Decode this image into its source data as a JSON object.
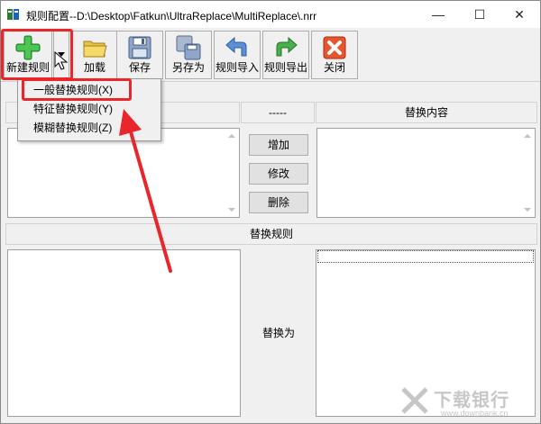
{
  "window": {
    "title": "规则配置--D:\\Desktop\\Fatkun\\UltraReplace\\MultiReplace\\.nrr",
    "minimize_glyph": "—",
    "maximize_glyph": "☐",
    "close_glyph": "✕"
  },
  "toolbar": {
    "new_rule_label": "新建规则",
    "load_label": "加载",
    "save_label": "保存",
    "save_as_label": "另存为",
    "import_label": "规则导入",
    "export_label": "规则导出",
    "close_label": "关闭"
  },
  "menu": {
    "items": [
      {
        "label": "一般替换规则(X)"
      },
      {
        "label": "特征替换规则(Y)"
      },
      {
        "label": "模糊替换规则(Z)"
      }
    ]
  },
  "upper": {
    "middle_header": "-----",
    "right_header": "替换内容",
    "add_button": "增加",
    "modify_button": "修改",
    "delete_button": "删除"
  },
  "lower": {
    "header": "替换规则",
    "replace_with_label": "替换为"
  },
  "watermark": {
    "text": "下载银行",
    "sub": "www.downbank.cn"
  },
  "colors": {
    "annotation_red": "#e8262b",
    "background": "#f0f0f0"
  }
}
